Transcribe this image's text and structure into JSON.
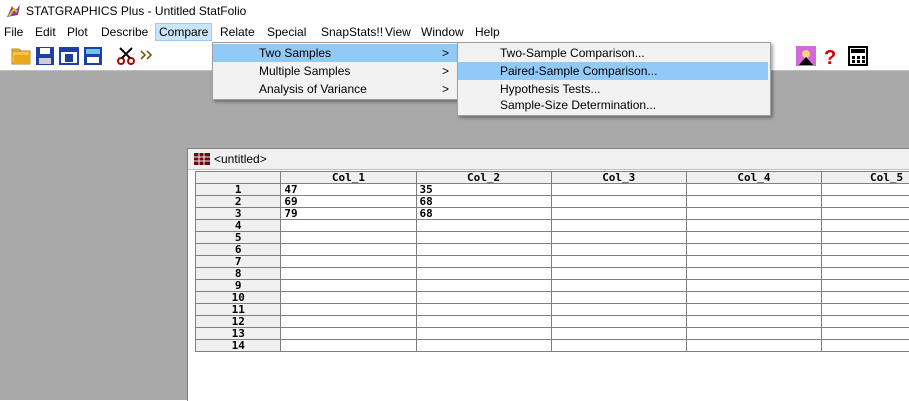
{
  "app": {
    "title": "STATGRAPHICS Plus - Untitled StatFolio"
  },
  "menubar": {
    "items": [
      "File",
      "Edit",
      "Plot",
      "Describe",
      "Compare",
      "Relate",
      "Special",
      "SnapStats!!",
      "View",
      "Window",
      "Help"
    ]
  },
  "compare_menu": {
    "items": [
      {
        "label": "Two Samples",
        "arrow": ">"
      },
      {
        "label": "Multiple Samples",
        "arrow": ">"
      },
      {
        "label": "Analysis of Variance",
        "arrow": ">"
      }
    ]
  },
  "two_samples_menu": {
    "items": [
      "Two-Sample Comparison...",
      "Paired-Sample Comparison...",
      "Hypothesis Tests...",
      "Sample-Size Determination..."
    ]
  },
  "sheet": {
    "title": "<untitled>",
    "columns": [
      "Col_1",
      "Col_2",
      "Col_3",
      "Col_4",
      "Col_5"
    ],
    "rows": [
      {
        "n": "1",
        "c1": "47",
        "c2": "35"
      },
      {
        "n": "2",
        "c1": "69",
        "c2": "68"
      },
      {
        "n": "3",
        "c1": "79",
        "c2": "68"
      },
      {
        "n": "4",
        "c1": "",
        "c2": ""
      },
      {
        "n": "5",
        "c1": "",
        "c2": ""
      },
      {
        "n": "6",
        "c1": "",
        "c2": ""
      },
      {
        "n": "7",
        "c1": "",
        "c2": ""
      },
      {
        "n": "8",
        "c1": "",
        "c2": ""
      },
      {
        "n": "9",
        "c1": "",
        "c2": ""
      },
      {
        "n": "10",
        "c1": "",
        "c2": ""
      },
      {
        "n": "11",
        "c1": "",
        "c2": ""
      },
      {
        "n": "12",
        "c1": "",
        "c2": ""
      },
      {
        "n": "13",
        "c1": "",
        "c2": ""
      },
      {
        "n": "14",
        "c1": "",
        "c2": ""
      }
    ]
  },
  "toolbar": {
    "icons": [
      "open-folder-icon",
      "save-icon",
      "spreadsheet-icon",
      "data-editor-icon",
      "cut-icon",
      "transpose-icon",
      "reader-icon",
      "help-icon",
      "calculator-icon"
    ]
  },
  "colors": {
    "workspace": "#a9a9a9",
    "highlight": "#91c9f7",
    "menu_open": "#cce4f7"
  }
}
